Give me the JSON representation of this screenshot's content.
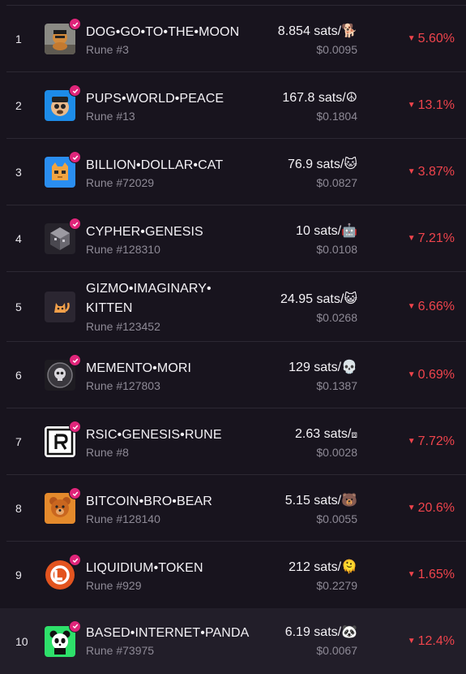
{
  "colors": {
    "negative": "#f0444c",
    "verified": "#e0257a",
    "background": "#18141e",
    "muted": "#8e8a96"
  },
  "rows": [
    {
      "rank": "1",
      "name": "DOG•GO•TO•THE•MOON",
      "rune": "Rune #3",
      "price": "8.854 sats/",
      "symbol": "🐕",
      "usd": "$0.0095",
      "change": "5.60%",
      "logo": "dog-logo"
    },
    {
      "rank": "2",
      "name": "PUPS•WORLD•PEACE",
      "rune": "Rune #13",
      "price": "167.8 sats/",
      "symbol": "☮",
      "usd": "$0.1804",
      "change": "13.1%",
      "logo": "pups-logo"
    },
    {
      "rank": "3",
      "name": "BILLION•DOLLAR•CAT",
      "rune": "Rune #72029",
      "price": "76.9 sats/",
      "symbol": "🐱",
      "usd": "$0.0827",
      "change": "3.87%",
      "logo": "cat-logo"
    },
    {
      "rank": "4",
      "name": "CYPHER•GENESIS",
      "rune": "Rune #128310",
      "price": "10 sats/",
      "symbol": "🤖",
      "usd": "$0.0108",
      "change": "7.21%",
      "logo": "cypher-logo"
    },
    {
      "rank": "5",
      "name": "GIZMO•IMAGINARY•",
      "name2": "KITTEN",
      "rune": "Rune #123452",
      "price": "24.95 sats/",
      "symbol": "😺",
      "usd": "$0.0268",
      "change": "6.66%",
      "logo": "gizmo-logo"
    },
    {
      "rank": "6",
      "name": "MEMENTO•MORI",
      "rune": "Rune #127803",
      "price": "129 sats/",
      "symbol": "💀",
      "usd": "$0.1387",
      "change": "0.69%",
      "logo": "memento-logo"
    },
    {
      "rank": "7",
      "name": "RSIC•GENESIS•RUNE",
      "rune": "Rune #8",
      "price": "2.63 sats/",
      "symbol": "⧈",
      "usd": "$0.0028",
      "change": "7.72%",
      "logo": "rsic-logo"
    },
    {
      "rank": "8",
      "name": "BITCOIN•BRO•BEAR",
      "rune": "Rune #128140",
      "price": "5.15 sats/",
      "symbol": "🐻",
      "usd": "$0.0055",
      "change": "20.6%",
      "logo": "bear-logo"
    },
    {
      "rank": "9",
      "name": "LIQUIDIUM•TOKEN",
      "rune": "Rune #929",
      "price": "212 sats/",
      "symbol": "🫠",
      "usd": "$0.2279",
      "change": "1.65%",
      "logo": "liquidium-logo"
    },
    {
      "rank": "10",
      "name": "BASED•INTERNET•PANDA",
      "rune": "Rune #73975",
      "price": "6.19 sats/",
      "symbol": "🐼",
      "usd": "$0.0067",
      "change": "12.4%",
      "logo": "panda-logo"
    }
  ]
}
